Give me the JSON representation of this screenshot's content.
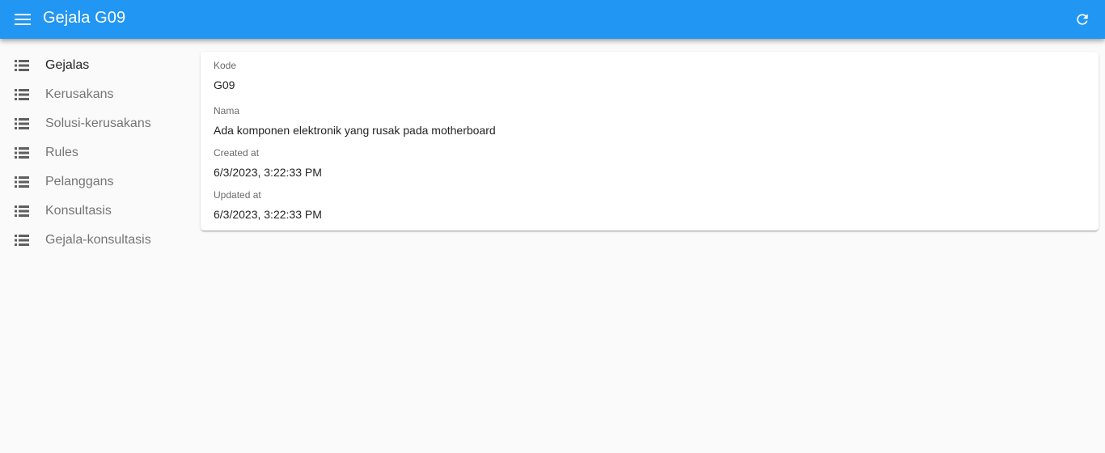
{
  "appbar": {
    "title": "Gejala G09",
    "menu_icon": "menu-icon",
    "refresh_icon": "refresh-icon",
    "color": "#2196f3"
  },
  "sidebar": {
    "items": [
      {
        "label": "Gejalas",
        "icon": "list-icon",
        "active": true
      },
      {
        "label": "Kerusakans",
        "icon": "list-icon",
        "active": false
      },
      {
        "label": "Solusi-kerusakans",
        "icon": "list-icon",
        "active": false
      },
      {
        "label": "Rules",
        "icon": "list-icon",
        "active": false
      },
      {
        "label": "Pelanggans",
        "icon": "list-icon",
        "active": false
      },
      {
        "label": "Konsultasis",
        "icon": "list-icon",
        "active": false
      },
      {
        "label": "Gejala-konsultasis",
        "icon": "list-icon",
        "active": false
      }
    ]
  },
  "record": {
    "fields": [
      {
        "label": "Kode",
        "value": "G09"
      },
      {
        "label": "Nama",
        "value": "Ada komponen elektronik yang rusak pada motherboard"
      },
      {
        "label": "Created at",
        "value": "6/3/2023, 3:22:33 PM"
      },
      {
        "label": "Updated at",
        "value": "6/3/2023, 3:22:33 PM"
      }
    ]
  }
}
